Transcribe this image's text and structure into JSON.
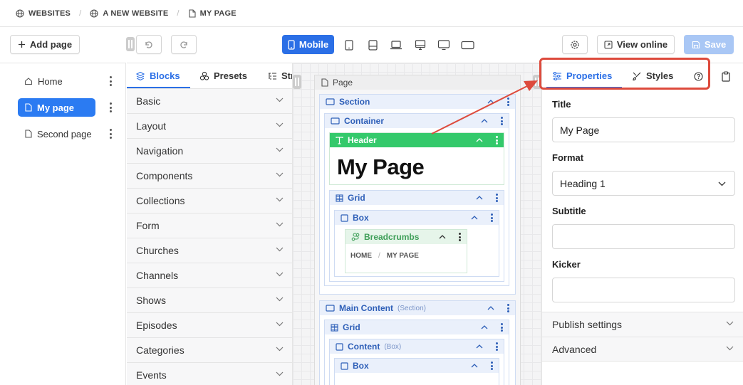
{
  "breadcrumb": [
    "WEBSITES",
    "A NEW WEBSITE",
    "MY PAGE"
  ],
  "toolbar": {
    "add_page": "Add page",
    "device_active": "Mobile",
    "view_online": "View online",
    "save": "Save"
  },
  "pages": [
    "Home",
    "My page",
    "Second page"
  ],
  "panel_tabs": [
    "Blocks",
    "Presets",
    "Structure"
  ],
  "categories": [
    "Basic",
    "Layout",
    "Navigation",
    "Components",
    "Collections",
    "Form",
    "Churches",
    "Channels",
    "Shows",
    "Episodes",
    "Categories",
    "Events"
  ],
  "canvas": {
    "page": "Page",
    "section": "Section",
    "container": "Container",
    "header": "Header",
    "heading_text": "My Page",
    "grid": "Grid",
    "box": "Box",
    "breadcrumbs": "Breadcrumbs",
    "crumb_home": "HOME",
    "crumb_sep": "/",
    "crumb_page": "MY PAGE",
    "main_content": "Main Content",
    "main_content_hint": "(Section)",
    "grid2": "Grid",
    "content": "Content",
    "content_hint": "(Box)",
    "box2": "Box"
  },
  "right_tabs": [
    "Properties",
    "Styles"
  ],
  "properties": {
    "title_label": "Title",
    "title_value": "My Page",
    "format_label": "Format",
    "format_value": "Heading 1",
    "subtitle_label": "Subtitle",
    "subtitle_value": "",
    "kicker_label": "Kicker",
    "kicker_value": "",
    "publish_settings": "Publish settings",
    "advanced": "Advanced"
  },
  "colors": {
    "accent": "#2b6fe6",
    "header_block": "#34c96b",
    "breadcrumbs_block": "#3f9f59",
    "annotation": "#dd4a3c"
  }
}
